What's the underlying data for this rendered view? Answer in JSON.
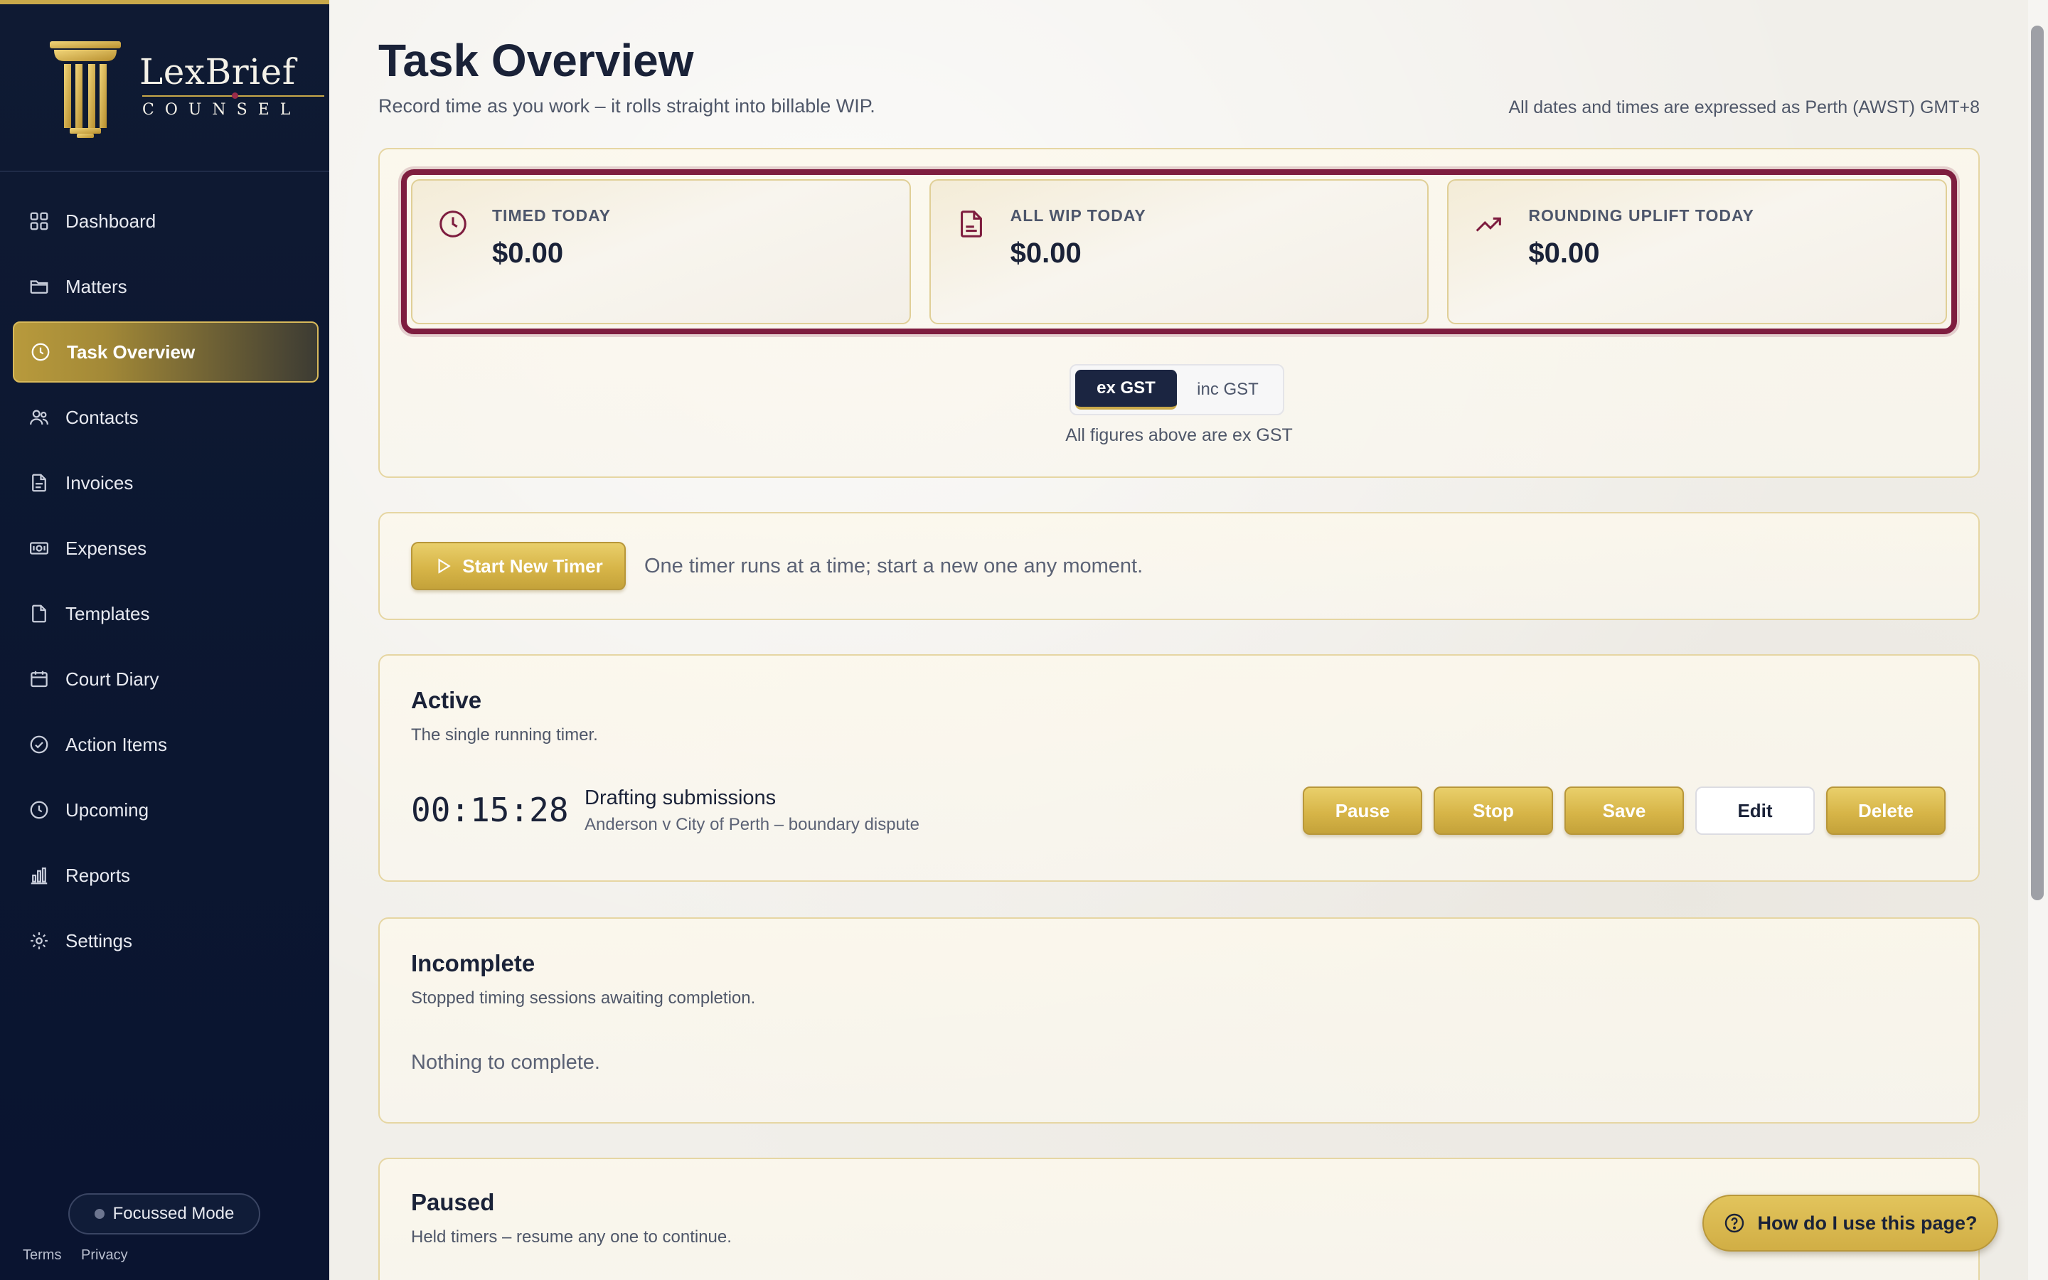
{
  "brand": {
    "name": "LexBrief",
    "tagline": "COUNSEL"
  },
  "sidebar": {
    "items": [
      {
        "label": "Dashboard",
        "icon": "grid-icon"
      },
      {
        "label": "Matters",
        "icon": "folder-icon"
      },
      {
        "label": "Task Overview",
        "icon": "clock-icon",
        "active": true
      },
      {
        "label": "Contacts",
        "icon": "users-icon"
      },
      {
        "label": "Invoices",
        "icon": "file-icon"
      },
      {
        "label": "Expenses",
        "icon": "banknote-icon"
      },
      {
        "label": "Templates",
        "icon": "document-icon"
      },
      {
        "label": "Court Diary",
        "icon": "calendar-icon"
      },
      {
        "label": "Action Items",
        "icon": "check-circle-icon"
      },
      {
        "label": "Upcoming",
        "icon": "clock-icon"
      },
      {
        "label": "Reports",
        "icon": "bar-chart-icon"
      },
      {
        "label": "Settings",
        "icon": "gear-icon"
      }
    ],
    "focus_mode_label": "Focussed Mode",
    "footer": {
      "terms": "Terms",
      "privacy": "Privacy"
    }
  },
  "header": {
    "title": "Task Overview",
    "subtitle": "Record time as you work – it rolls straight into billable WIP.",
    "timezone_note": "All dates and times are expressed as Perth (AWST) GMT+8"
  },
  "summary": {
    "stats": [
      {
        "label": "TIMED TODAY",
        "value": "$0.00",
        "icon": "clock-icon"
      },
      {
        "label": "ALL WIP TODAY",
        "value": "$0.00",
        "icon": "document-icon"
      },
      {
        "label": "ROUNDING UPLIFT TODAY",
        "value": "$0.00",
        "icon": "trending-up-icon"
      }
    ],
    "gst_toggle": {
      "ex": "ex GST",
      "inc": "inc GST",
      "selected": "ex GST"
    },
    "gst_note": "All figures above are ex GST"
  },
  "timer": {
    "start_label": "Start New Timer",
    "hint": "One timer runs at a time; start a new one any moment."
  },
  "active": {
    "title": "Active",
    "subtitle": "The single running timer.",
    "entry": {
      "elapsed": "00:15:28",
      "task": "Drafting submissions",
      "matter": "Anderson v City of Perth – boundary dispute"
    },
    "actions": {
      "pause": "Pause",
      "stop": "Stop",
      "save": "Save",
      "edit": "Edit",
      "delete": "Delete"
    }
  },
  "incomplete": {
    "title": "Incomplete",
    "subtitle": "Stopped timing sessions awaiting completion.",
    "empty": "Nothing to complete."
  },
  "paused": {
    "title": "Paused",
    "subtitle": "Held timers – resume any one to continue."
  },
  "help_label": "How do I use this page?",
  "colors": {
    "accent_gold": "#d7b548",
    "navy": "#0f1a33",
    "burgundy": "#7e1d3f"
  }
}
